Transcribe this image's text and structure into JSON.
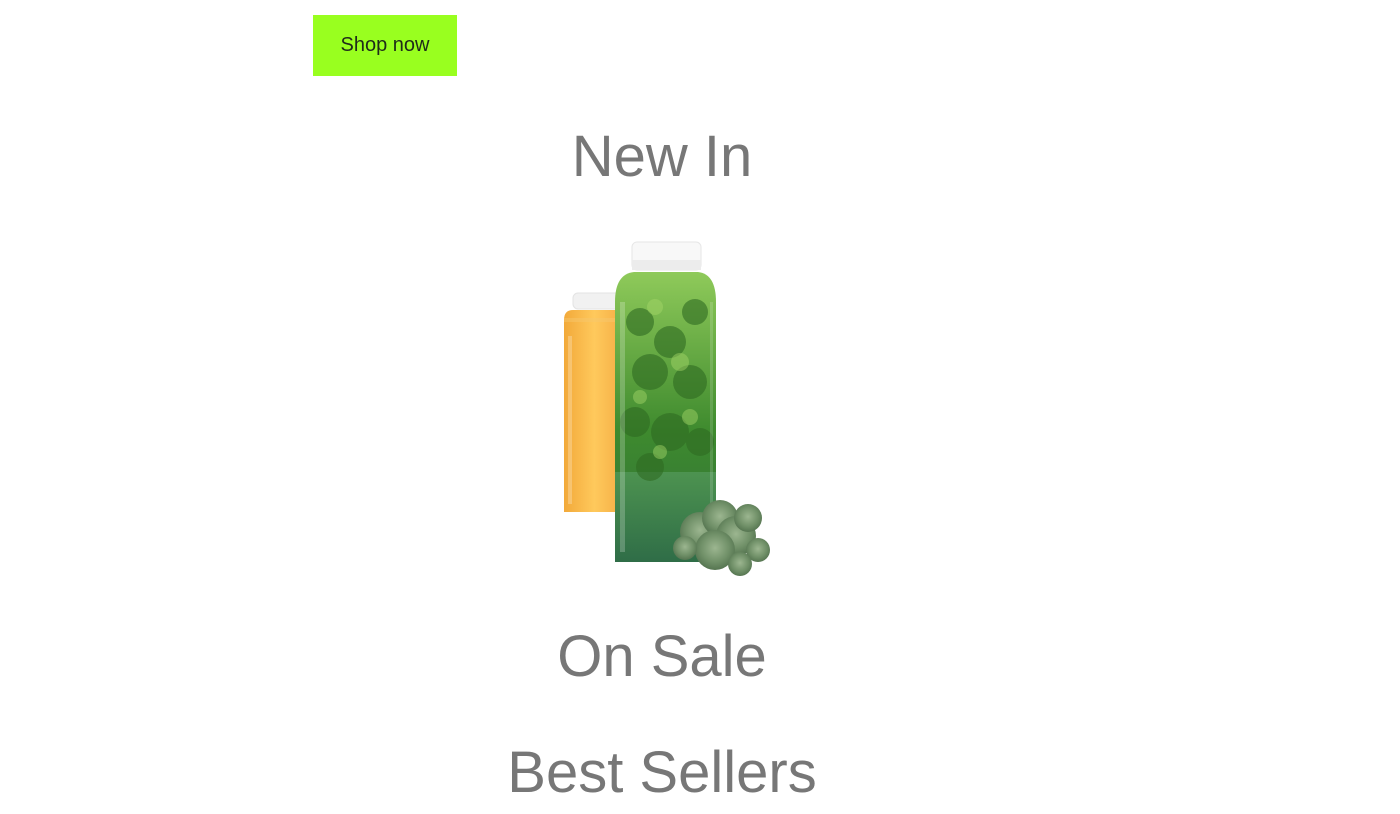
{
  "hero": {
    "cta_label": "Shop now",
    "cta_color": "#99ff1f"
  },
  "sections": {
    "new_in": "New In",
    "on_sale": "On Sale",
    "best_sellers": "Best Sellers"
  },
  "product_image": {
    "alt": "juice bottles"
  },
  "colors": {
    "heading": "#777777",
    "background": "#ffffff"
  }
}
